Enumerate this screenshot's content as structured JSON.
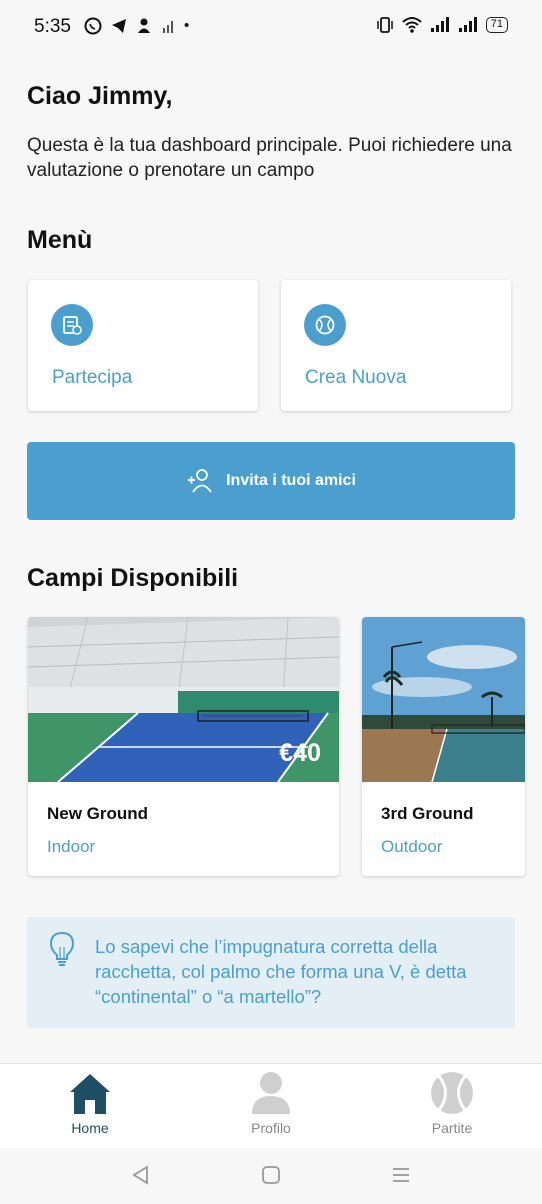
{
  "status": {
    "time": "5:35",
    "battery": "71",
    "left_icons": [
      "whatsapp-icon",
      "telegram-icon",
      "person-icon",
      "signal-icon",
      "dot-icon"
    ],
    "right_icons": [
      "vibrate-icon",
      "wifi-icon",
      "signal-bars-icon",
      "signal-bars-icon"
    ]
  },
  "greeting": "Ciao Jimmy,",
  "intro": "Questa è la tua dashboard principale. Puoi richiedere una valutazione o prenotare un campo",
  "menu": {
    "title": "Menù",
    "items": [
      {
        "label": "Partecipa",
        "icon": "calendar-icon"
      },
      {
        "label": "Crea Nuova",
        "icon": "tennis-ball-icon"
      }
    ]
  },
  "invite": {
    "label": "Invita i tuoi amici",
    "icon": "add-user-icon"
  },
  "fields": {
    "title": "Campi Disponibili",
    "items": [
      {
        "name": "New Ground",
        "type": "Indoor",
        "price": "€40"
      },
      {
        "name": "3rd Ground",
        "type": "Outdoor"
      }
    ]
  },
  "tip": {
    "text": "Lo sapevi che l’impugnatura corretta della racchetta, col palmo che forma una V, è detta “continental” o “a martello”?",
    "icon": "lightbulb-icon"
  },
  "nav": {
    "items": [
      {
        "label": "Home",
        "icon": "home-icon",
        "active": true
      },
      {
        "label": "Profilo",
        "icon": "person-icon",
        "active": false
      },
      {
        "label": "Partite",
        "icon": "tennis-ball-icon",
        "active": false
      }
    ]
  },
  "colors": {
    "accent": "#4a9fcf",
    "nav_active": "#1f4f66",
    "tip_bg": "#e3eef5"
  }
}
